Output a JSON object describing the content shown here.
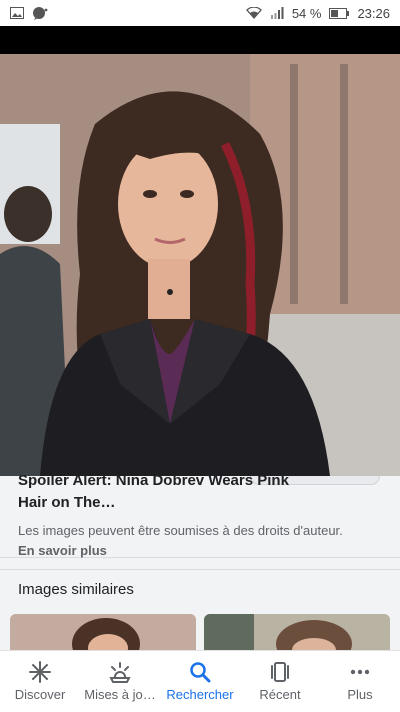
{
  "status_bar": {
    "battery": "54 %",
    "time": "23:26",
    "icons": [
      "image-icon",
      "chat-bubble-icon",
      "wifi-icon",
      "signal-icon",
      "battery-icon"
    ]
  },
  "result": {
    "title": "Spoiler Alert: Nina Dobrev Wears Pink Hair on The…",
    "copyright_text": "Les images peuvent être soumises à des droits d'auteur.",
    "learn_more": "En savoir plus"
  },
  "similar": {
    "title": "Images similaires"
  },
  "nav": {
    "items": [
      {
        "label": "Discover",
        "icon": "asterisk-icon"
      },
      {
        "label": "Mises à jo…",
        "icon": "updates-icon"
      },
      {
        "label": "Rechercher",
        "icon": "search-icon",
        "active": true
      },
      {
        "label": "Récent",
        "icon": "recent-icon"
      },
      {
        "label": "Plus",
        "icon": "more-dots-icon"
      }
    ]
  },
  "colors": {
    "accent": "#1a73e8",
    "text": "#202124",
    "muted": "#5f6368"
  }
}
